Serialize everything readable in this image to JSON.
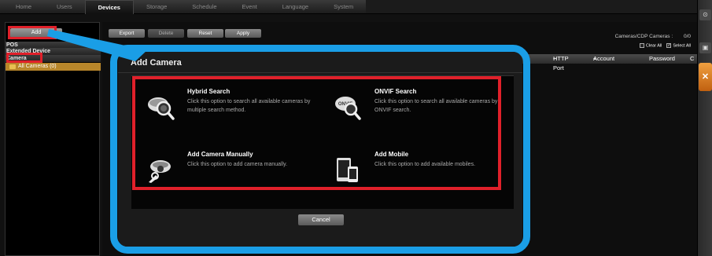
{
  "tabs": [
    {
      "label": "Home"
    },
    {
      "label": "Users"
    },
    {
      "label": "Devices",
      "active": true
    },
    {
      "label": "Storage"
    },
    {
      "label": "Schedule"
    },
    {
      "label": "Event"
    },
    {
      "label": "Language"
    },
    {
      "label": "System"
    }
  ],
  "left_panel": {
    "add_label": "Add",
    "categories": [
      "POS",
      "Extended Device",
      "Camera"
    ],
    "all_cameras": "All Cameras (0)"
  },
  "toolbar": {
    "export": "Export",
    "delete": "Delete",
    "reset": "Reset",
    "apply": "Apply"
  },
  "cdp": {
    "label": "Cameras/CDP Cameras :",
    "count": "0/0",
    "clear_all": "Clear All",
    "select_all": "Select All"
  },
  "columns": {
    "http_port": "HTTP Port",
    "account": "Account",
    "password": "Password",
    "c": "C"
  },
  "dialog": {
    "title": "Add Camera",
    "options": [
      {
        "title": "Hybrid Search",
        "desc": "Click this option to search all available cameras by multiple search method."
      },
      {
        "title": "ONVIF Search",
        "desc": "Click this option to search all available cameras by ONVIF search.",
        "icon_text": "ONVIF"
      },
      {
        "title": "Add Camera Manually",
        "desc": "Click this option to add camera manually."
      },
      {
        "title": "Add Mobile",
        "desc": "Click this option to add available mobiles."
      }
    ],
    "cancel": "Cancel"
  },
  "colors": {
    "highlight_red": "#e0202a",
    "callout_blue": "#1a9ee6",
    "selected_orange": "#b8862a"
  }
}
